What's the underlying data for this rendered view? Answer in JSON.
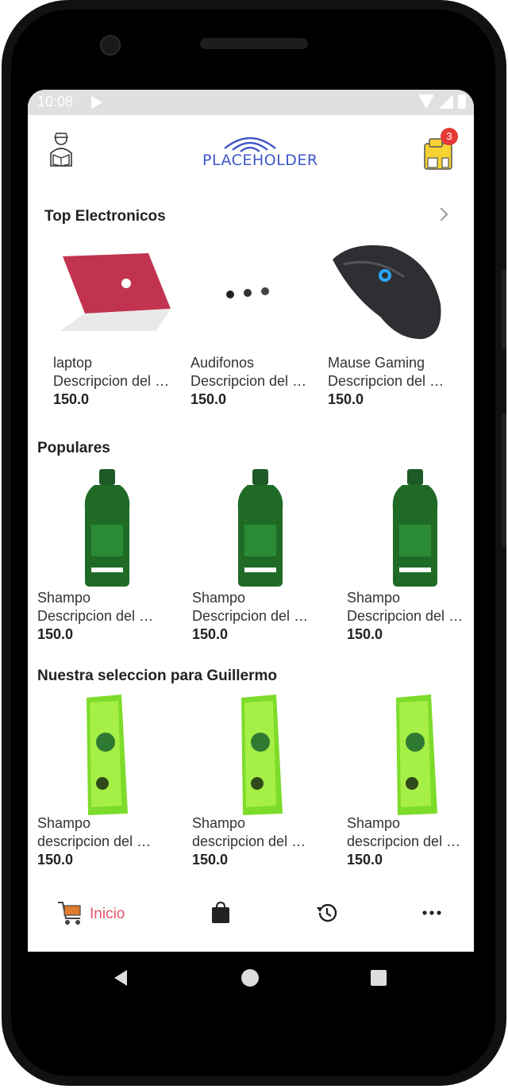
{
  "status_bar": {
    "time": "10:08"
  },
  "header": {
    "logo_text": "PLACEHOLDER",
    "cart_count": "3"
  },
  "sections": [
    {
      "title": "Top Electronicos",
      "products": [
        {
          "name": "laptop",
          "description": "Descripcion del producto",
          "price": "150.0"
        },
        {
          "name": "Audifonos",
          "description": "Descripcion del producto",
          "price": "150.0"
        },
        {
          "name": "Mause Gaming",
          "description": "Descripcion del producto",
          "price": "150.0"
        }
      ]
    },
    {
      "title": "Populares",
      "products": [
        {
          "name": "Shampo",
          "description": "Descripcion del producto",
          "price": "150.0"
        },
        {
          "name": "Shampo",
          "description": "Descripcion del producto",
          "price": "150.0"
        },
        {
          "name": "Shampo",
          "description": "Descripcion del producto",
          "price": "150.0"
        }
      ]
    },
    {
      "title": "Nuestra seleccion para Guillermo",
      "products": [
        {
          "name": "Shampo",
          "description": "descripcion del producto",
          "price": "150.0"
        },
        {
          "name": "Shampo",
          "description": "descripcion del producto",
          "price": "150.0"
        },
        {
          "name": "Shampo",
          "description": "descripcion del producto",
          "price": "150.0"
        }
      ]
    }
  ],
  "bottom_nav": {
    "items": [
      {
        "label": "Inicio",
        "icon": "shopping-cart-icon",
        "active": true
      },
      {
        "label": "",
        "icon": "shopping-bag-icon"
      },
      {
        "label": "",
        "icon": "history-icon"
      },
      {
        "label": "",
        "icon": "more-horizontal-icon"
      }
    ]
  },
  "colors": {
    "accent": "#e2566a",
    "logo": "#3f56c9",
    "badge": "#e53935"
  }
}
